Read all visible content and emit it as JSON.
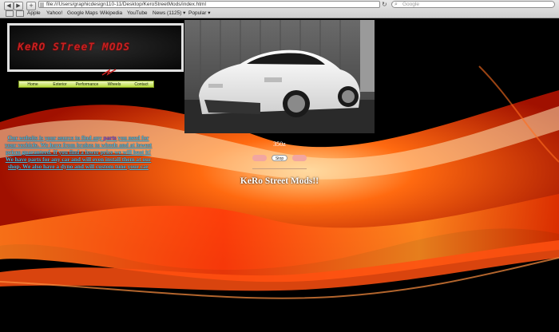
{
  "browser": {
    "url": "file:///Users/graphicdesign110-11/Desktop/KeroStreetMods/index.html",
    "search_placeholder": "Google",
    "back": "◀",
    "forward": "▶",
    "add": "+",
    "reload": "↻",
    "bookmarks": [
      "Apple",
      "Yahoo!",
      "Google Maps",
      "Wikipedia",
      "YouTube",
      "News (1125) ▾",
      "Popular ▾"
    ]
  },
  "site": {
    "logo_text": "KeRO STreeT MODS",
    "nav": [
      "Home",
      "Exterior",
      "Performance",
      "Wheels",
      "Contact"
    ],
    "hero_caption": "350z",
    "slideshow": {
      "prev": "Prev",
      "stop": "Stop",
      "next": "Next"
    },
    "headline": "KeRo Street Mods!!",
    "intro_before": "Our website is your source to find any ",
    "intro_link": "parts",
    "intro_after": " you need for your vechicle. We have from brakes to wheels and at lowest prices guaranteed. If you find a lower price we will beat it! We have parts for any car and will even install them at our shop. We also have a dyno and will custom tune your car"
  },
  "colors": {
    "accent_red": "#c82020",
    "nav_green": "#b7db3b",
    "intro_text": "#4db7d6"
  }
}
